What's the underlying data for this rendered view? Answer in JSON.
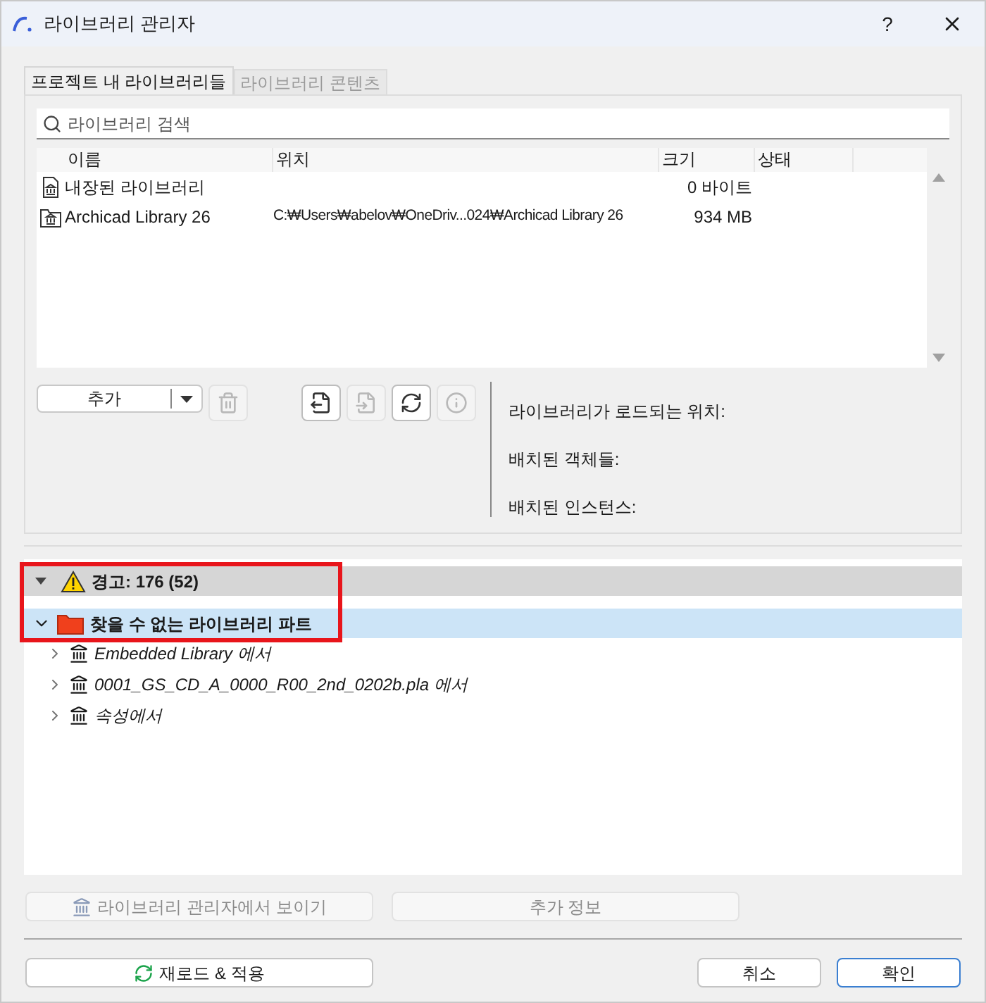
{
  "window": {
    "title": "라이브러리 관리자",
    "help": "?"
  },
  "tabs": [
    {
      "label": "프로젝트 내 라이브러리들",
      "selected": true
    },
    {
      "label": "라이브러리 콘텐츠",
      "selected": false
    }
  ],
  "search": {
    "placeholder": "라이브러리 검색"
  },
  "table": {
    "columns": [
      "이름",
      "위치",
      "크기",
      "상태"
    ],
    "rows": [
      {
        "kind": "embedded",
        "name": "내장된 라이브러리",
        "size": "0 바이트"
      },
      {
        "kind": "linked",
        "name": "Archicad Library 26",
        "location": "C:₩Users₩abelov₩OneDriv...024₩Archicad Library 26",
        "size": "934 MB"
      }
    ]
  },
  "toolbar": {
    "add_button": "추가",
    "icon_buttons": [
      {
        "kind": "remove",
        "disabled": true
      },
      {
        "kind": "export",
        "disabled": false
      },
      {
        "kind": "import",
        "disabled": true
      },
      {
        "kind": "reload",
        "disabled": false
      },
      {
        "kind": "info",
        "disabled": true
      }
    ]
  },
  "info_labels": [
    "라이브러리가 로드되는 위치:",
    "배치된 객체들:",
    "배치된 인스턴스:"
  ],
  "warnings": {
    "header": "경고: 176 (52)",
    "expanded": true,
    "groups": [
      {
        "label": "찾을 수 없는 라이브러리 파트",
        "expanded": true,
        "selected": true,
        "children": [
          {
            "label": "Embedded Library 에서",
            "expanded": false
          },
          {
            "label": "0001_GS_CD_A_0000_R00_2nd_0202b.pla 에서",
            "expanded": false
          },
          {
            "label": "속성에서",
            "expanded": false
          }
        ]
      }
    ]
  },
  "actions": [
    {
      "kind": "library",
      "label": "라이브러리 관리자에서 보이기",
      "disabled": true
    },
    {
      "kind": "plain",
      "label": "추가 정보",
      "disabled": true
    }
  ],
  "footer": {
    "reload": "재로드 & 적용",
    "cancel": "취소",
    "ok": "확인"
  }
}
